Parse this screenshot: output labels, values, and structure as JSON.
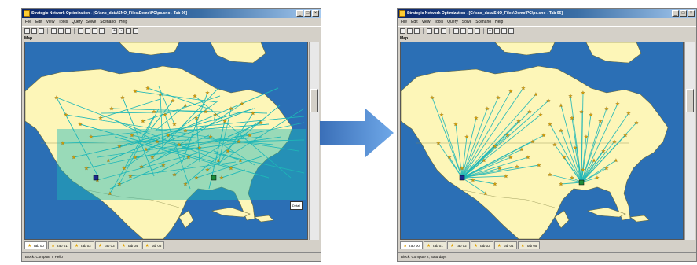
{
  "colors": {
    "ocean": "#2b6fb5",
    "land": "#fdf6b8",
    "route": "#1fb7b7",
    "arrow_start": "#3a6fb8",
    "arrow_end": "#6fa8e8"
  },
  "left_window": {
    "title": "Strategic Network Optimization - [C:\\sno_data\\SNO_Files\\Demo\\PC\\pc.sno - Tab 06]",
    "menu": [
      "File",
      "Edit",
      "View",
      "Tools",
      "Query",
      "Solve",
      "Scenario",
      "Help"
    ],
    "panel_label": "Map",
    "tabs": [
      "Tab 00",
      "Tab 01",
      "Tab 02",
      "Tab 03",
      "Tab 04",
      "Tab 05"
    ],
    "popup": "Detail",
    "status": "Block: Compute T, Hello"
  },
  "right_window": {
    "title": "Strategic Network Optimization - [C:\\sno_data\\SNO_Files\\Demo\\PC\\pc.sno - Tab 06]",
    "menu": [
      "File",
      "Edit",
      "View",
      "Tools",
      "Query",
      "Solve",
      "Scenario",
      "Help"
    ],
    "panel_label": "Map",
    "tabs": [
      "Tab 00",
      "Tab 01",
      "Tab 02",
      "Tab 03",
      "Tab 04",
      "Tab 05"
    ],
    "status": "Block: Compute 2, Saturdays"
  },
  "icons": {
    "app": "app-icon",
    "minimize": "minimize-icon",
    "maximize": "maximize-icon",
    "close": "close-icon",
    "site": "star-site-icon",
    "transition": "right-arrow-icon"
  }
}
